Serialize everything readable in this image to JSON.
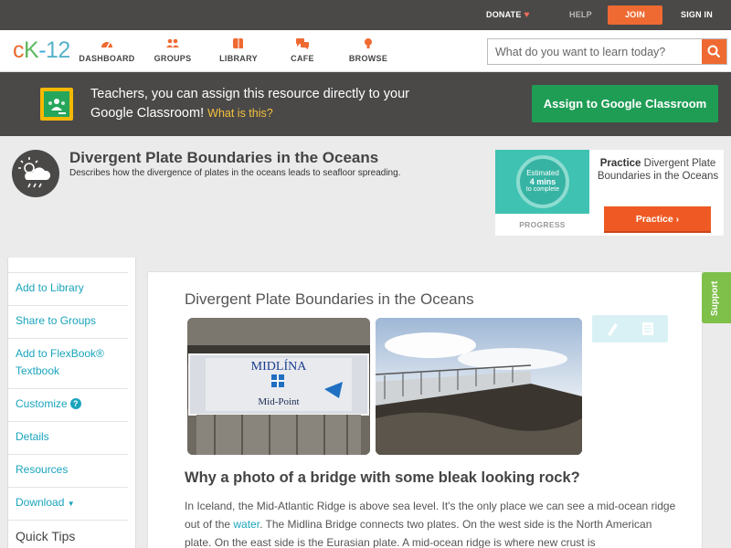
{
  "topbar": {
    "donate": "DONATE",
    "help": "HELP",
    "join": "JOIN",
    "signin": "SIGN IN"
  },
  "nav": {
    "logo_c": "c",
    "logo_k": "K",
    "logo_dash": "-",
    "logo_num": "12",
    "items": [
      {
        "label": "DASHBOARD",
        "icon": "dashboard-icon"
      },
      {
        "label": "GROUPS",
        "icon": "groups-icon"
      },
      {
        "label": "LIBRARY",
        "icon": "library-icon"
      },
      {
        "label": "CAFE",
        "icon": "cafe-icon"
      },
      {
        "label": "BROWSE",
        "icon": "browse-icon"
      }
    ],
    "search_placeholder": "What do you want to learn today?"
  },
  "classroom": {
    "message": "Teachers, you can assign this resource directly to your Google Classroom!",
    "what_is_this": "What is this?",
    "button": "Assign to Google Classroom"
  },
  "concept": {
    "title": "Divergent Plate Boundaries in the Oceans",
    "description": "Describes how the divergence of plates in the oceans leads to seafloor spreading."
  },
  "practice": {
    "estimated": "Estimated",
    "mins": "4 mins",
    "to_complete": "to complete",
    "progress": "PROGRESS",
    "heading_bold": "Practice",
    "heading_rest": "Divergent Plate Boundaries in the Oceans",
    "button": "Practice"
  },
  "sidebar": {
    "items": [
      "Add to Library",
      "Share to Groups",
      "Add to FlexBook®",
      "Textbook",
      "Customize",
      "Details",
      "Resources",
      "Download",
      "Quick Tips"
    ]
  },
  "content": {
    "title": "Divergent Plate Boundaries in the Oceans",
    "sign_title": "MIDLÍNA",
    "sign_subtitle": "Mid-Point",
    "question": "Why a photo of a bridge with some bleak looking rock?",
    "p1_a": "In Iceland, the Mid-Atlantic Ridge is above sea level. It's the only place we can see a mid-ocean ridge out of the ",
    "p1_link": "water",
    "p1_b": ". The Midlina Bridge connects two plates. On the west side is the North American plate. On the east side is the Eurasian plate. A mid-ocean ridge is where new crust is"
  },
  "support": "Support",
  "colors": {
    "accent_orange": "#ef6a32",
    "link_teal": "#1aa4bd",
    "classroom_green": "#1f9d55",
    "dark_bar": "#4a4948"
  }
}
